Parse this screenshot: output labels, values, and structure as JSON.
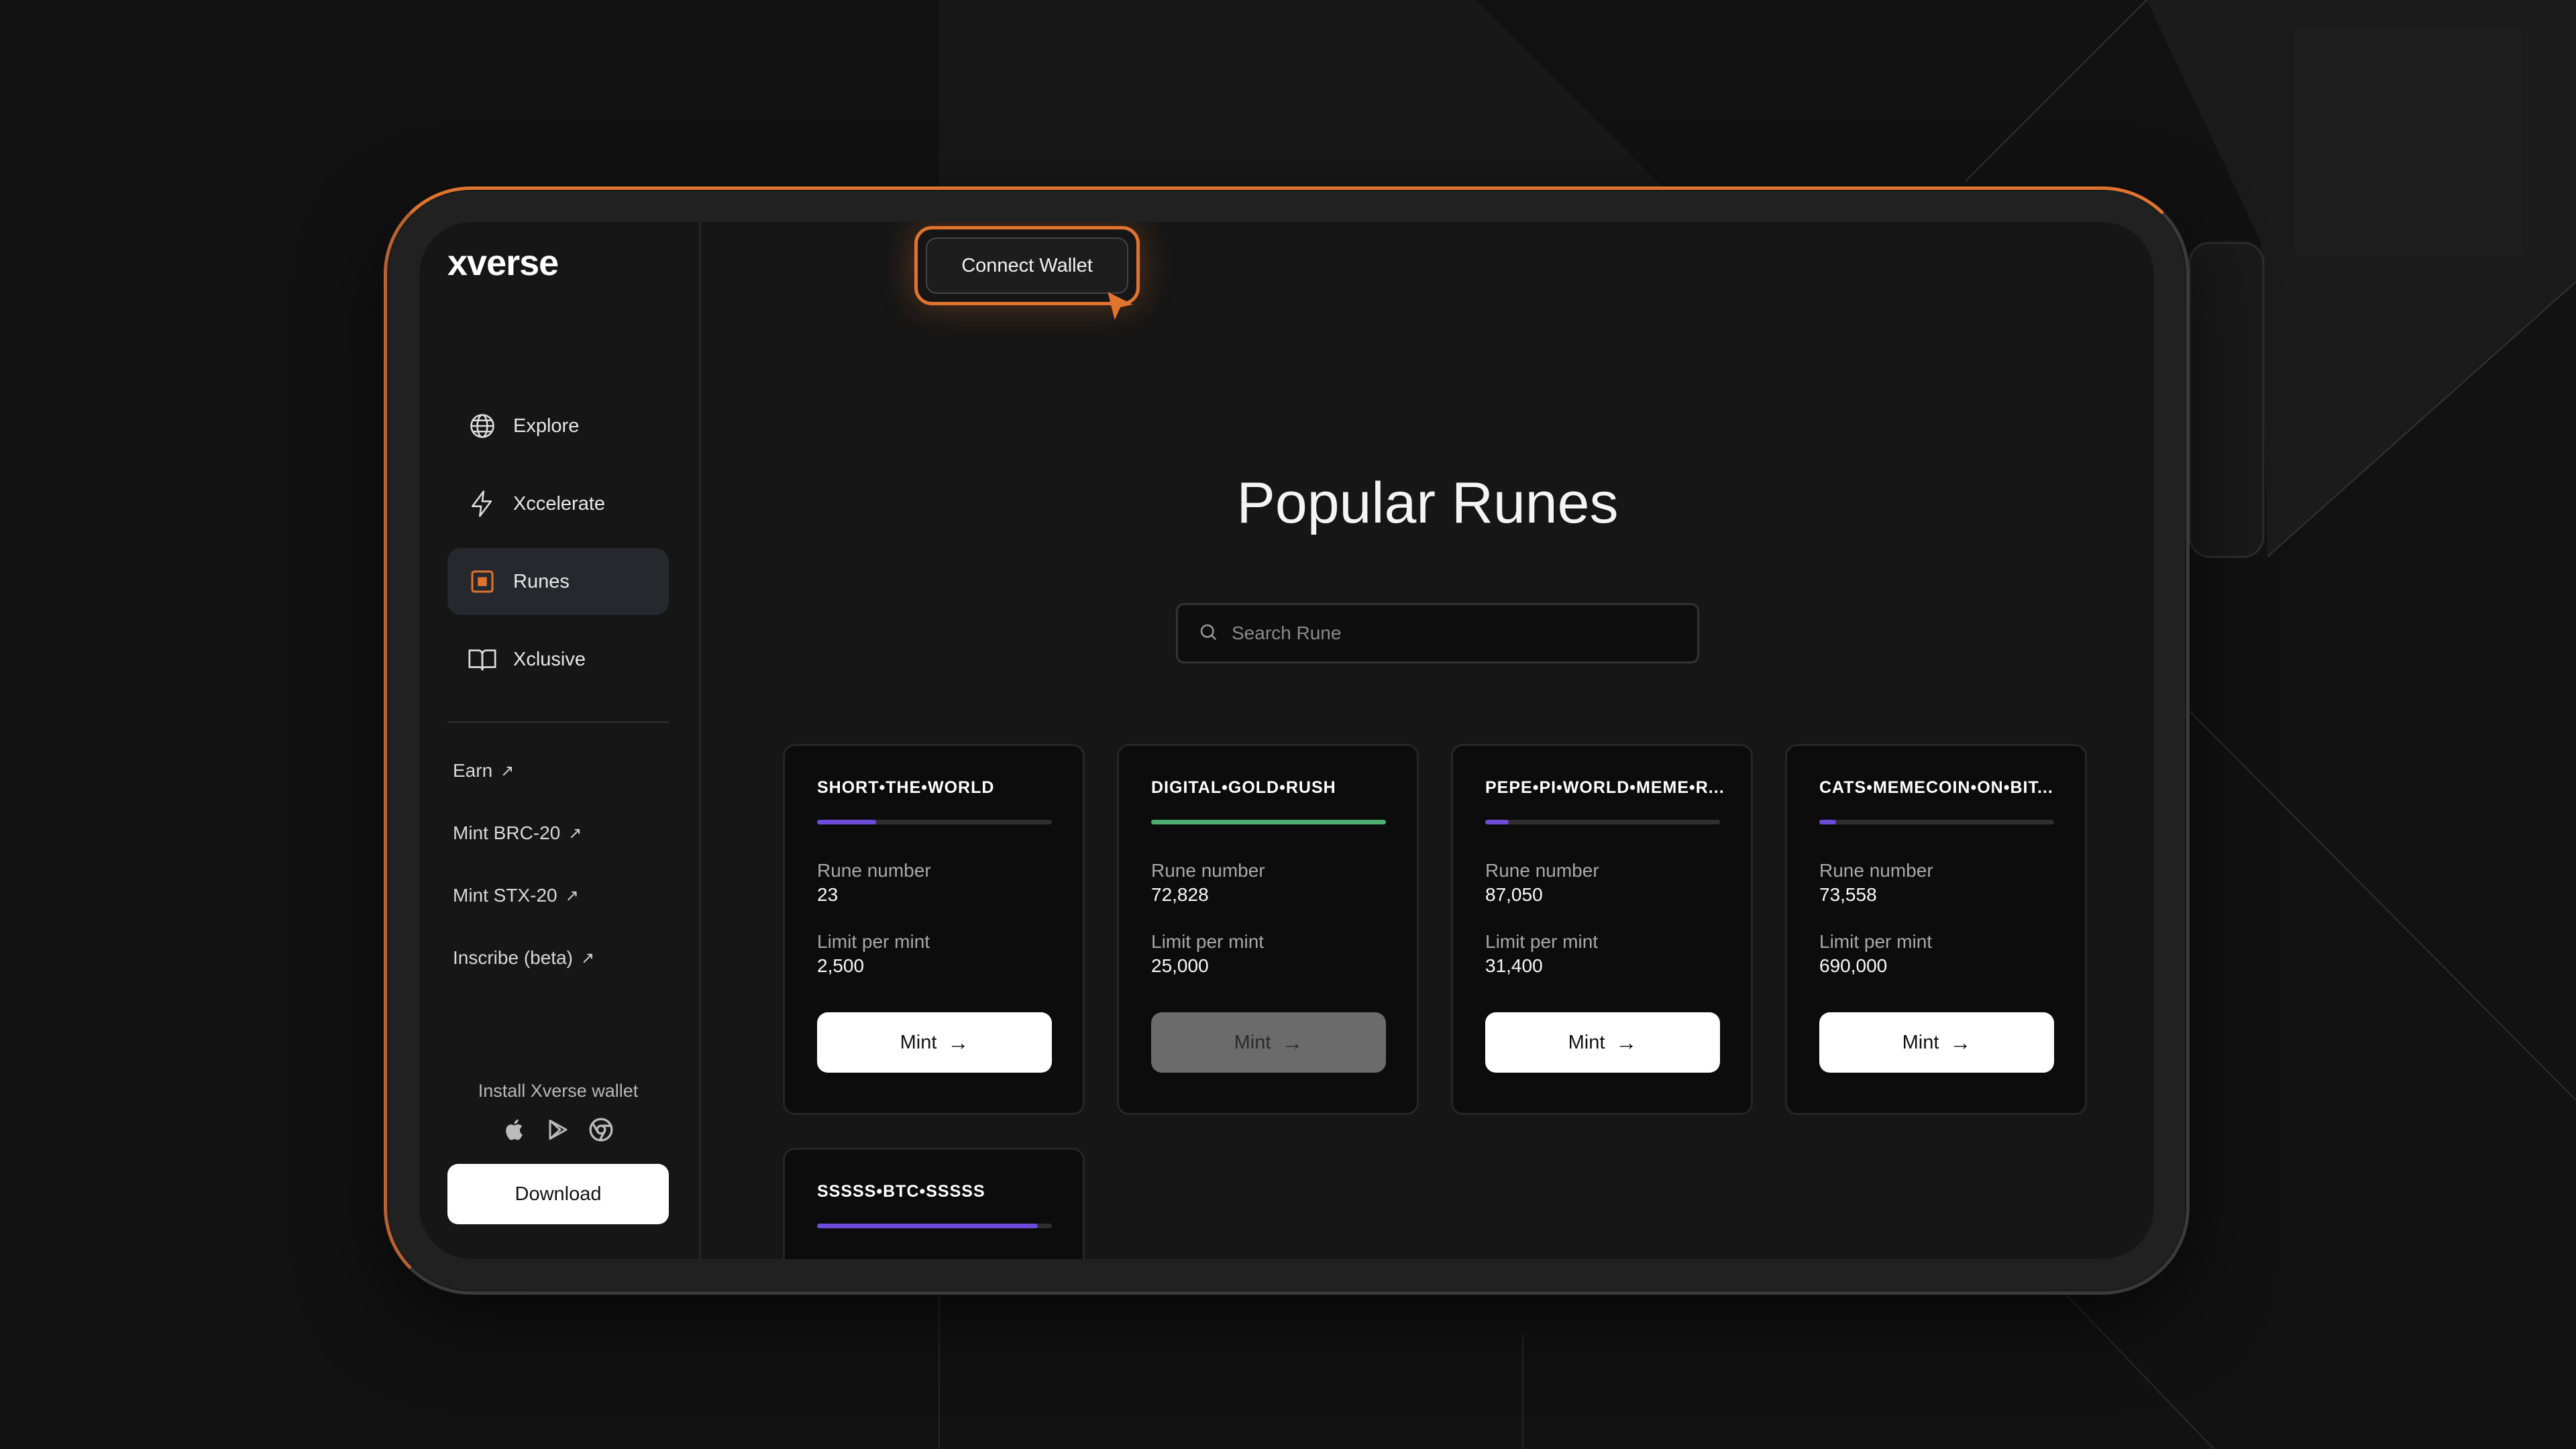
{
  "logo": "xverse",
  "connect_wallet": "Connect Wallet",
  "sidebar": {
    "nav": [
      {
        "label": "Explore",
        "icon": "globe-icon"
      },
      {
        "label": "Xccelerate",
        "icon": "lightning-icon"
      },
      {
        "label": "Runes",
        "icon": "rune-square-icon",
        "active": true
      },
      {
        "label": "Xclusive",
        "icon": "book-icon"
      }
    ],
    "links": [
      {
        "label": "Earn"
      },
      {
        "label": "Mint BRC-20"
      },
      {
        "label": "Mint STX-20"
      },
      {
        "label": "Inscribe (beta)"
      }
    ],
    "install_label": "Install Xverse wallet",
    "store_icons": [
      "apple-icon",
      "google-play-icon",
      "chrome-icon"
    ],
    "download_label": "Download"
  },
  "main": {
    "title": "Popular Runes",
    "search_placeholder": "Search Rune"
  },
  "labels": {
    "rune_number": "Rune number",
    "limit": "Limit per mint",
    "mint": "Mint"
  },
  "runes": [
    {
      "name": "SHORT•THE•WORLD",
      "progress": 0.25,
      "bar_color": "#6b4bd8",
      "rune_number": "23",
      "limit": "2,500",
      "mint_enabled": true
    },
    {
      "name": "DIGITAL•GOLD•RUSH",
      "progress": 1.0,
      "bar_color": "#4caf6e",
      "rune_number": "72,828",
      "limit": "25,000",
      "mint_enabled": false
    },
    {
      "name": "PEPE•PI•WORLD•MEME•R...",
      "progress": 0.1,
      "bar_color": "#6b4bd8",
      "rune_number": "87,050",
      "limit": "31,400",
      "mint_enabled": true
    },
    {
      "name": "CATS•MEMECOIN•ON•BIT...",
      "progress": 0.07,
      "bar_color": "#6b4bd8",
      "rune_number": "73,558",
      "limit": "690,000",
      "mint_enabled": true
    },
    {
      "name": "SSSSS•BTC•SSSSS",
      "progress": 0.94,
      "bar_color": "#6b4bd8"
    }
  ],
  "colors": {
    "accent": "#e0742e",
    "background": "#121212"
  }
}
